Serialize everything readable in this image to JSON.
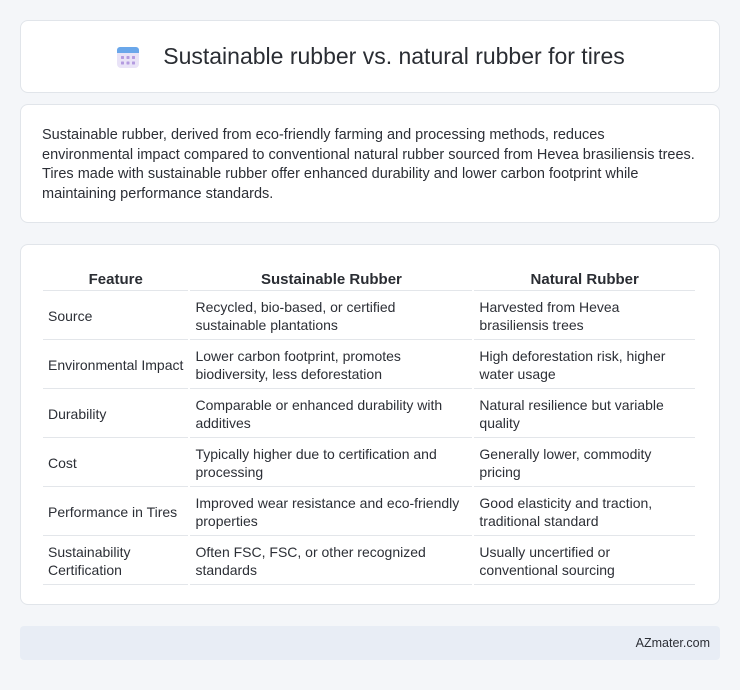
{
  "header": {
    "title": "Sustainable rubber vs. natural rubber for tires",
    "icon": "calendar-icon"
  },
  "intro": {
    "text": "Sustainable rubber, derived from eco-friendly farming and processing methods, reduces environmental impact compared to conventional natural rubber sourced from Hevea brasiliensis trees. Tires made with sustainable rubber offer enhanced durability and lower carbon footprint while maintaining performance standards."
  },
  "table": {
    "headers": [
      "Feature",
      "Sustainable Rubber",
      "Natural Rubber"
    ],
    "rows": [
      [
        "Source",
        "Recycled, bio-based, or certified sustainable plantations",
        "Harvested from Hevea brasiliensis trees"
      ],
      [
        "Environmental Impact",
        "Lower carbon footprint, promotes biodiversity, less deforestation",
        "High deforestation risk, higher water usage"
      ],
      [
        "Durability",
        "Comparable or enhanced durability with additives",
        "Natural resilience but variable quality"
      ],
      [
        "Cost",
        "Typically higher due to certification and processing",
        "Generally lower, commodity pricing"
      ],
      [
        "Performance in Tires",
        "Improved wear resistance and eco-friendly properties",
        "Good elasticity and traction, traditional standard"
      ],
      [
        "Sustainability Certification",
        "Often FSC, FSC, or other recognized standards",
        "Usually uncertified or conventional sourcing"
      ]
    ]
  },
  "footer": {
    "brand": "AZmater.com"
  }
}
